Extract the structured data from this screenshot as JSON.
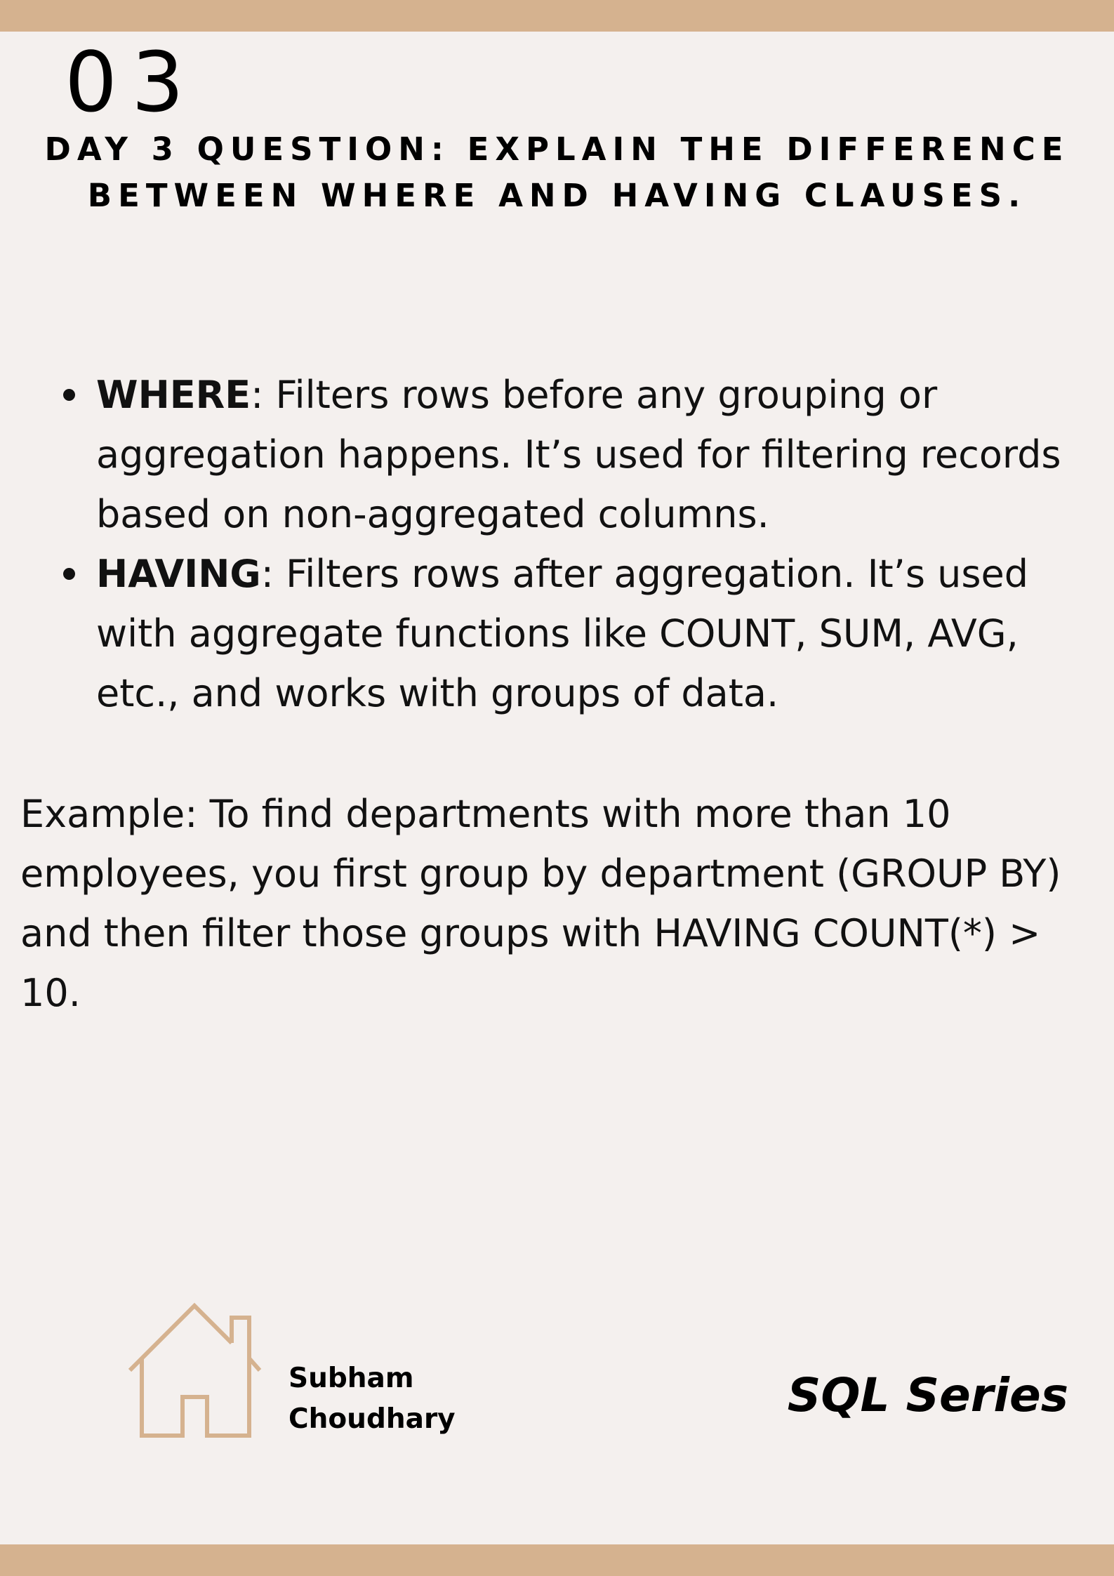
{
  "page": {
    "number": "03",
    "question": "Day 3 Question: Explain the difference between WHERE and HAVING clauses."
  },
  "bullets": [
    {
      "term": "WHERE",
      "text": ": Filters rows before any grouping or aggregation happens. It’s used for filtering records based on non-aggregated columns."
    },
    {
      "term": "HAVING",
      "text": ": Filters rows after aggregation. It’s used with aggregate functions like COUNT, SUM, AVG, etc., and works with groups of data."
    }
  ],
  "example": "Example: To find departments with more than 10 employees, you first group by department (GROUP BY) and then filter those groups with HAVING COUNT(*) > 10.",
  "footer": {
    "author_first": "Subham",
    "author_last": "Choudhary",
    "series": "SQL Series",
    "logo_icon": "house-icon"
  },
  "colors": {
    "accent": "#d5b28f",
    "background": "#f4f0ee",
    "text": "#000000"
  }
}
